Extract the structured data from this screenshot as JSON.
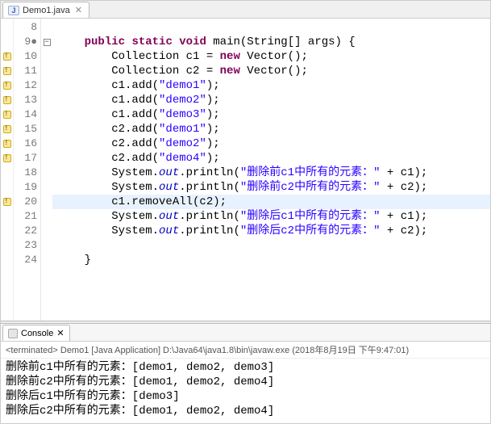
{
  "tab": {
    "title": "Demo1.java",
    "closeGlyph": "✕"
  },
  "gutter": {
    "lines": [
      "8",
      "9",
      "10",
      "11",
      "12",
      "13",
      "14",
      "15",
      "16",
      "17",
      "18",
      "19",
      "20",
      "21",
      "22",
      "23",
      "24"
    ],
    "warningRows": [
      "10",
      "11",
      "12",
      "13",
      "14",
      "15",
      "16",
      "17",
      "20"
    ],
    "foldRow": "9",
    "foldGlyph": "−",
    "indicatorRow": "9",
    "indicatorGlyph": "●"
  },
  "code": {
    "kw_public": "public",
    "kw_static": "static",
    "kw_void": "void",
    "kw_new": "new",
    "sig_main": " main(String[] args) {",
    "decl_c1_a": "Collection c1 = ",
    "decl_c1_b": " Vector();",
    "decl_c2_a": "Collection c2 = ",
    "decl_c2_b": " Vector();",
    "call_c1_add_pre": "c1.add(",
    "call_c2_add_pre": "c2.add(",
    "close_call": ");",
    "s_demo1": "\"demo1\"",
    "s_demo2": "\"demo2\"",
    "s_demo3": "\"demo3\"",
    "s_demo4": "\"demo4\"",
    "sys": "System.",
    "out": "out",
    "println_open": ".println(",
    "msg_before_c1": "\"删除前c1中所有的元素：\"",
    "msg_before_c2": "\"删除前c2中所有的元素：\"",
    "msg_after_c1": "\"删除后c1中所有的元素：\"",
    "msg_after_c2": "\"删除后c2中所有的元素：\"",
    "plus_c1": " + c1);",
    "plus_c2": " + c2);",
    "removeAll": "c1.removeAll(c2);",
    "brace_close": "}",
    "highlightLine": "20"
  },
  "console": {
    "tabLabel": "Console",
    "closeGlyph": "✕",
    "info": "<terminated> Demo1 [Java Application] D:\\Java64\\java1.8\\bin\\javaw.exe (2018年8月19日 下午9:47:01)",
    "lines": [
      "删除前c1中所有的元素：[demo1, demo2, demo3]",
      "删除前c2中所有的元素：[demo1, demo2, demo4]",
      "删除后c1中所有的元素：[demo3]",
      "删除后c2中所有的元素：[demo1, demo2, demo4]"
    ]
  }
}
